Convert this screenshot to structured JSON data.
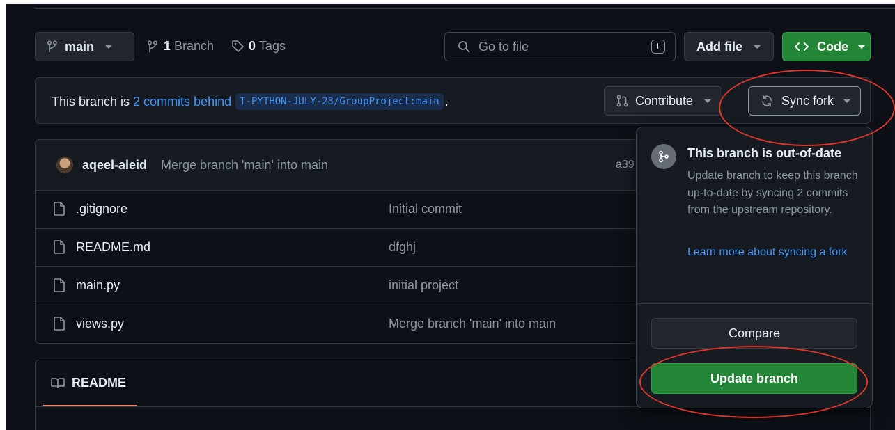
{
  "toolbar": {
    "branch_label": "main",
    "branches_count": "1",
    "branches_label": "Branch",
    "tags_count": "0",
    "tags_label": "Tags",
    "search_placeholder": "Go to file",
    "search_shortcut": "t",
    "add_file_label": "Add file",
    "code_label": "Code"
  },
  "fork_status": {
    "prefix": "This branch is ",
    "behind_link": "2 commits behind",
    "upstream_ref": "T-PYTHON-JULY-23/GroupProject:main",
    "suffix": ".",
    "contribute_label": "Contribute",
    "sync_label": "Sync fork"
  },
  "latest_commit": {
    "author": "aqeel-aleid",
    "message": "Merge branch 'main' into main",
    "hash_partial": "a39"
  },
  "files": [
    {
      "name": ".gitignore",
      "message": "Initial commit"
    },
    {
      "name": "README.md",
      "message": "dfghj"
    },
    {
      "name": "main.py",
      "message": "initial project"
    },
    {
      "name": "views.py",
      "message": "Merge branch 'main' into main"
    }
  ],
  "readme": {
    "tab_label": "README"
  },
  "sync_popover": {
    "title": "This branch is out-of-date",
    "body": "Update branch to keep this branch up-to-date by syncing 2 commits from the upstream repository.",
    "learn_more": "Learn more about syncing a fork",
    "compare_label": "Compare",
    "update_label": "Update branch"
  },
  "colors": {
    "background": "#0d1117",
    "accent_green": "#238636",
    "link_blue": "#4493f8",
    "highlight_red": "#e0362a"
  }
}
